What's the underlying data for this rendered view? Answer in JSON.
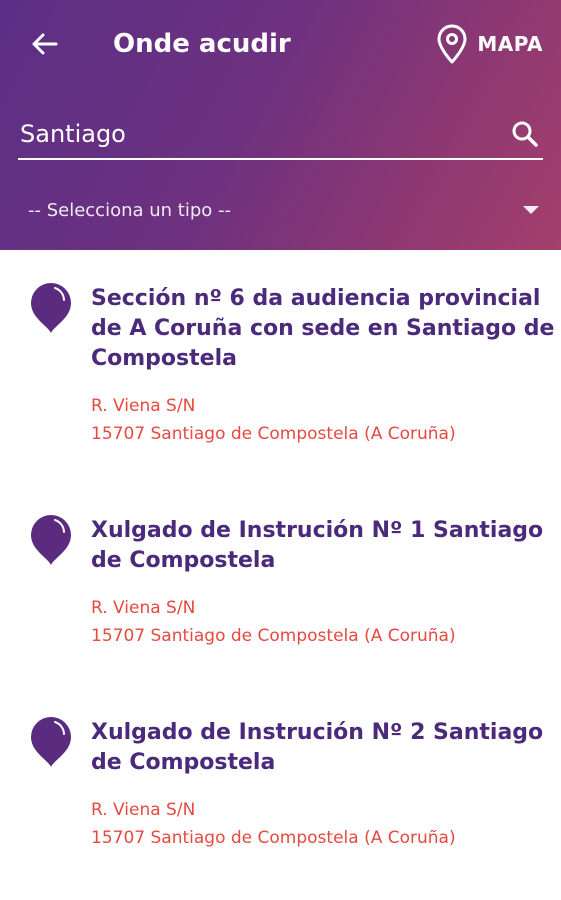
{
  "header": {
    "title": "Onde acudir",
    "map_label": "MAPA"
  },
  "search": {
    "value": "Santiago",
    "placeholder": ""
  },
  "filter": {
    "selected": "-- Selecciona un tipo --"
  },
  "results": [
    {
      "name": "Sección nº 6 da audiencia provincial de A Coruña con sede en Santiago de Compostela",
      "street": "R. Viena S/N",
      "city": "15707 Santiago de Compostela (A Coruña)"
    },
    {
      "name": "Xulgado de Instrución Nº 1 Santiago de Compostela",
      "street": "R. Viena S/N",
      "city": "15707 Santiago de Compostela (A Coruña)"
    },
    {
      "name": "Xulgado de Instrución Nº 2 Santiago de Compostela",
      "street": "R. Viena S/N",
      "city": "15707 Santiago de Compostela (A Coruña)"
    }
  ],
  "colors": {
    "header_gradient_start": "#5b2f86",
    "header_gradient_end": "#a33f6c",
    "title_purple": "#4b2a7b",
    "pin_purple": "#5a2b7e",
    "address_red": "#e6493f"
  }
}
